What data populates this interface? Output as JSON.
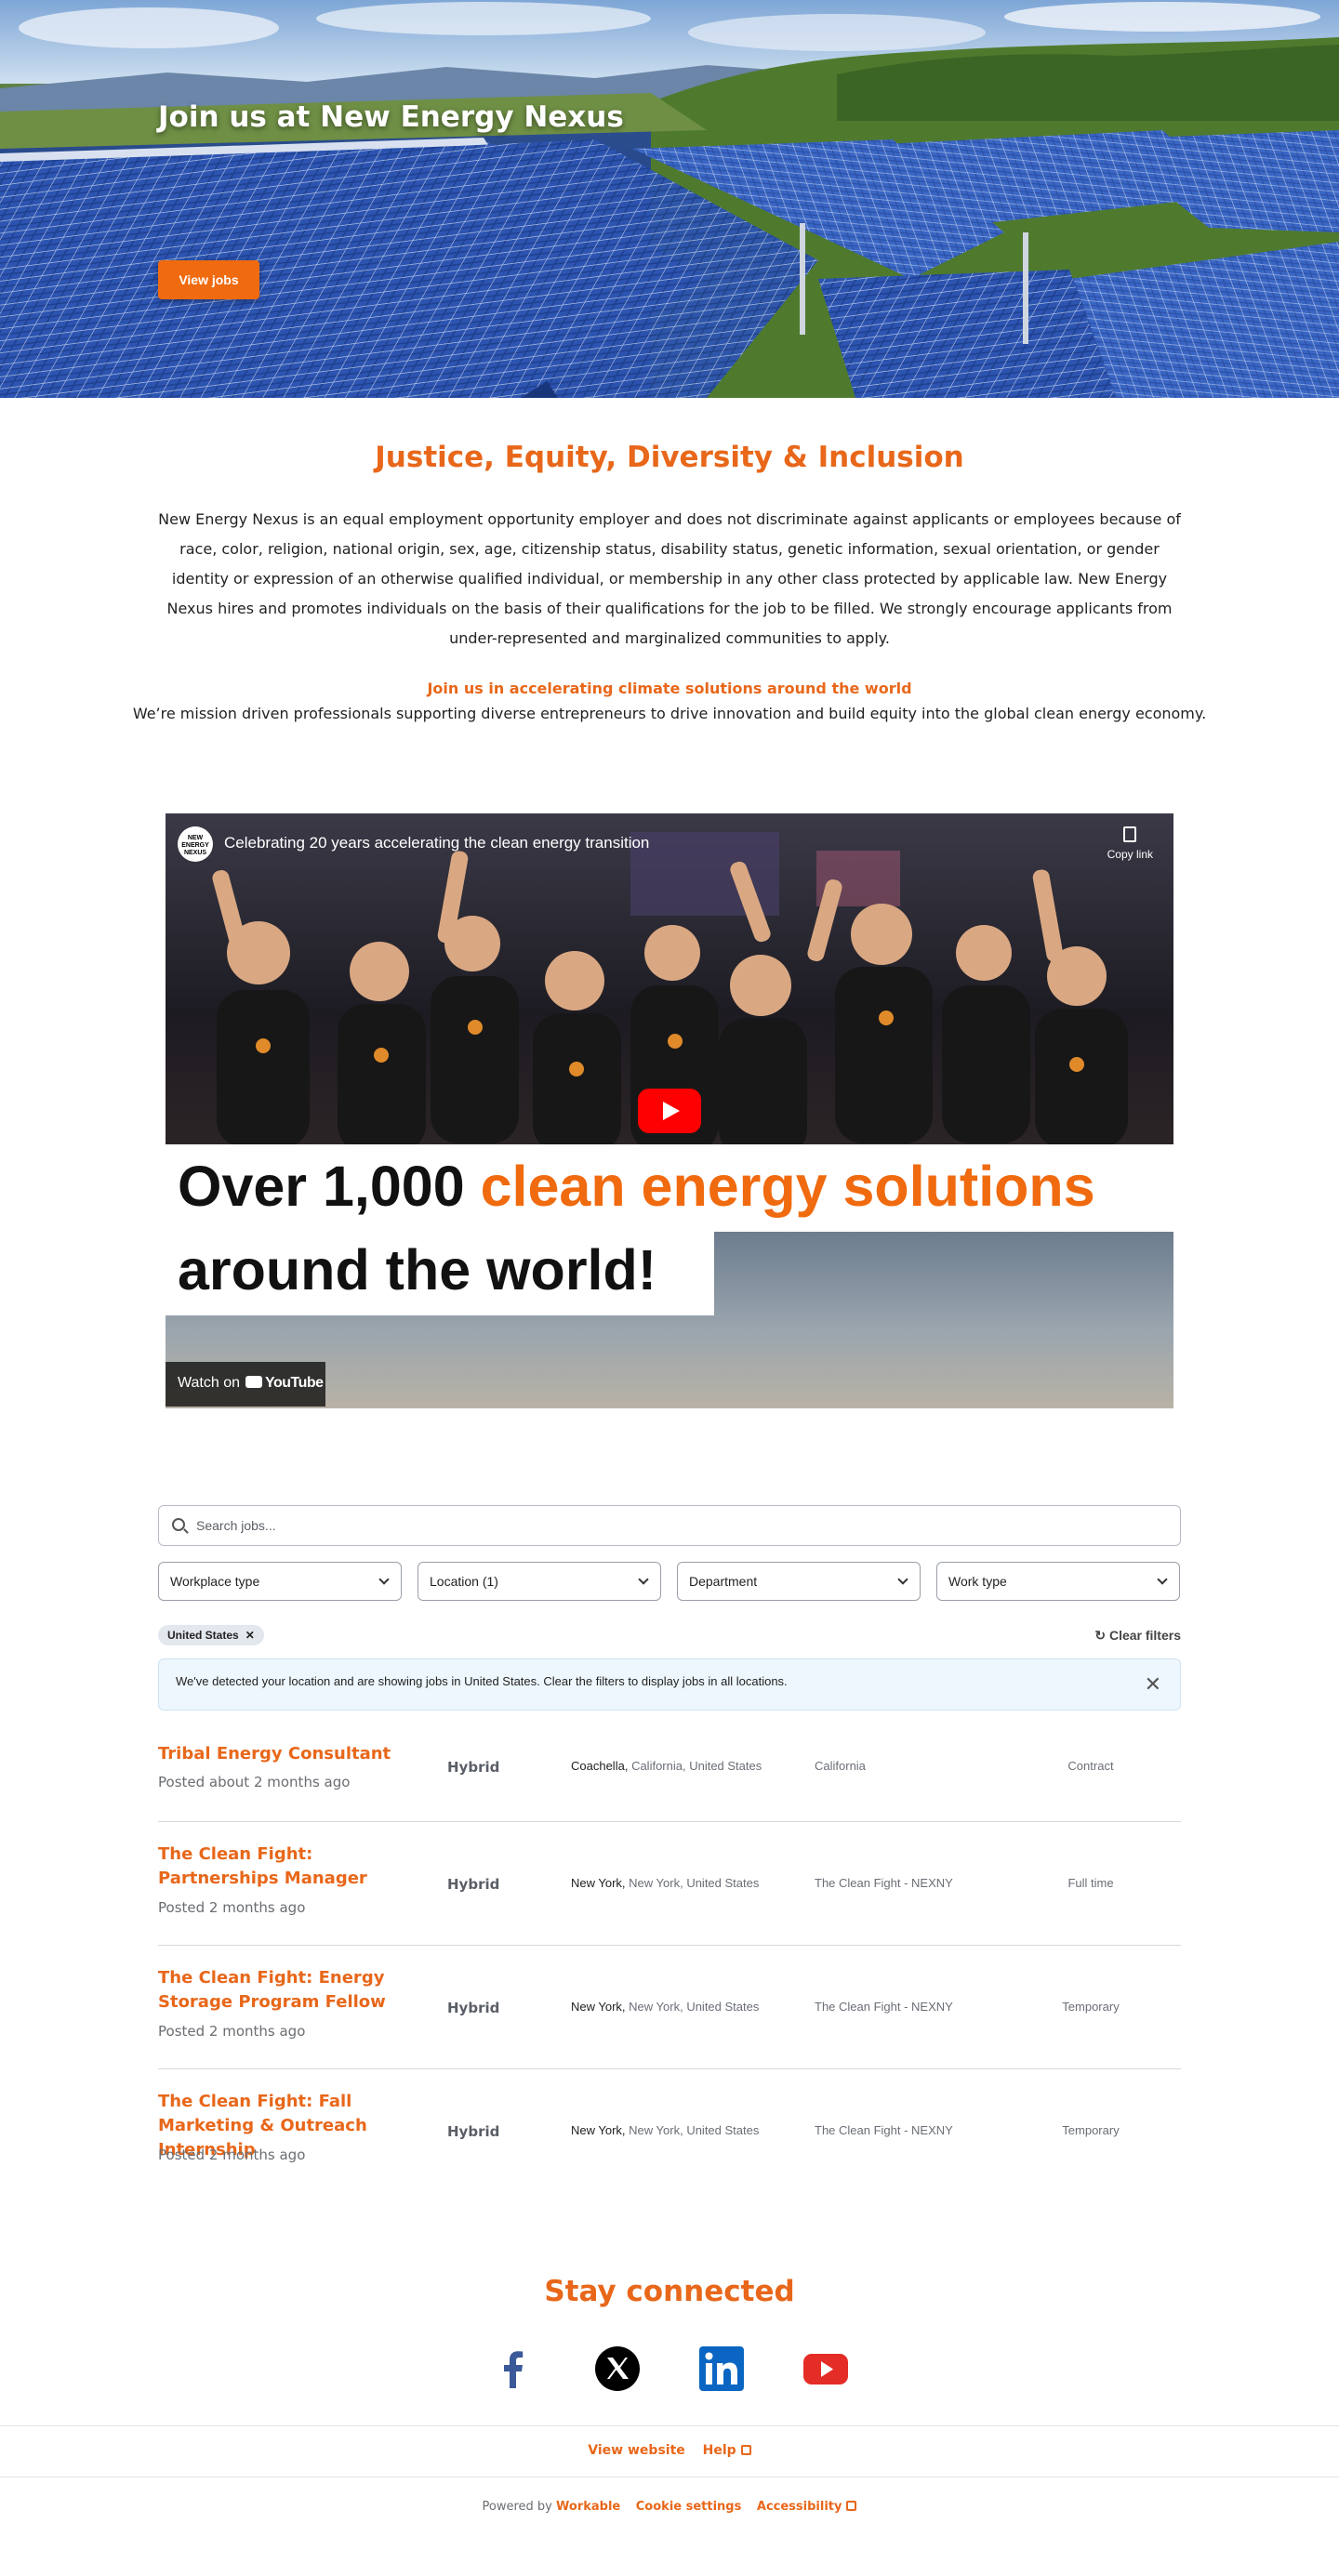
{
  "hero": {
    "title": "Join us at New Energy Nexus",
    "button_label": "View jobs"
  },
  "jedi": {
    "heading": "Justice, Equity, Diversity & Inclusion",
    "body": "New Energy Nexus is an equal employment opportunity employer and does not discriminate against applicants or employees because of race, color, religion, national origin, sex, age, citizenship status, disability status, genetic information, sexual orientation, or gender identity or expression of an otherwise qualified individual, or membership in any other class protected by applicable law. New Energy Nexus hires and promotes individuals on the basis of their qualifications for the job to be filled. We strongly encourage applicants from under-represented and marginalized communities to apply.",
    "subheading": "Join us in accelerating climate solutions around the world",
    "mission": "We’re mission driven professionals supporting diverse entrepreneurs to drive innovation and build equity into the global clean energy economy."
  },
  "video": {
    "channel_logo_text": "NEW ENERGY NEXUS",
    "title": "Celebrating 20 years accelerating the clean energy transition",
    "copy_link": "Copy link",
    "line1_prefix": "Over 1,000 ",
    "line1_highlight": "clean energy solutions",
    "line2": "around the world!",
    "watch_on": "Watch on",
    "youtube": "YouTube"
  },
  "jobs": {
    "search_placeholder": "Search jobs...",
    "filters": [
      "Workplace type",
      "Location (1)",
      "Department",
      "Work type"
    ],
    "chip_label": "United States",
    "clear_filters": "Clear filters",
    "notice": "We've detected your location and are showing jobs in United States. Clear the filters to display jobs in all locations.",
    "list": [
      {
        "title": "Tribal Energy Consultant",
        "posted": "Posted about 2 months ago",
        "workplace": "Hybrid",
        "city": "Coachella,",
        "region": "California, United States",
        "department": "California",
        "type": "Contract"
      },
      {
        "title": "The Clean Fight: Partnerships Manager",
        "posted": "Posted 2 months ago",
        "workplace": "Hybrid",
        "city": "New York,",
        "region": "New York, United States",
        "department": "The Clean Fight - NEXNY",
        "type": "Full time"
      },
      {
        "title": "The Clean Fight: Energy Storage Program Fellow",
        "posted": "Posted 2 months ago",
        "workplace": "Hybrid",
        "city": "New York,",
        "region": "New York, United States",
        "department": "The Clean Fight - NEXNY",
        "type": "Temporary"
      },
      {
        "title": "The Clean Fight: Fall Marketing & Outreach Internship",
        "posted": "Posted 2 months ago",
        "workplace": "Hybrid",
        "city": "New York,",
        "region": "New York, United States",
        "department": "The Clean Fight - NEXNY",
        "type": "Temporary"
      }
    ]
  },
  "stay": {
    "heading": "Stay connected",
    "icons": [
      "facebook-icon",
      "x-twitter-icon",
      "linkedin-icon",
      "youtube-icon"
    ]
  },
  "footer": {
    "view_website": "View website",
    "help": "Help",
    "powered_by": "Powered by",
    "workable": "Workable",
    "cookie_settings": "Cookie settings",
    "accessibility": "Accessibility"
  },
  "colors": {
    "accent": "#e8671a",
    "button": "#f06a0f",
    "facebook": "#3b5998",
    "linkedin": "#0a66c2",
    "youtube": "#e52d27"
  }
}
